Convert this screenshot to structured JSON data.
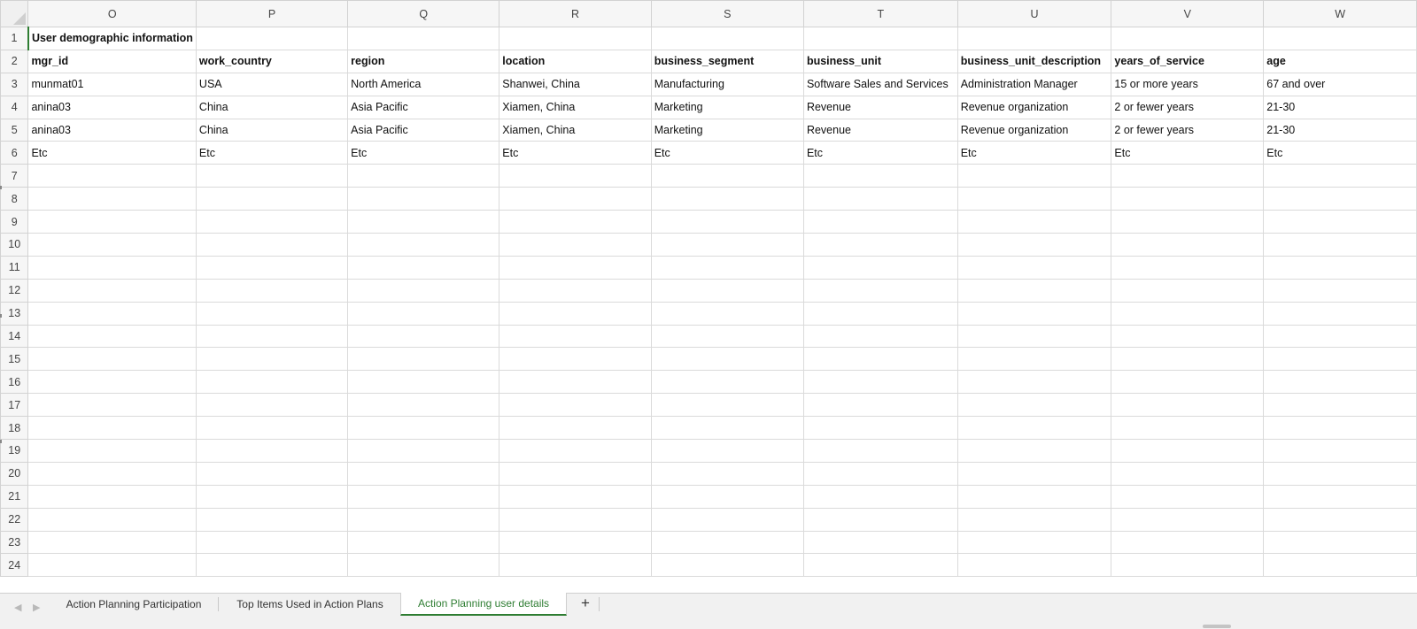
{
  "columns": [
    "O",
    "P",
    "Q",
    "R",
    "S",
    "T",
    "U",
    "V",
    "W"
  ],
  "rows": [
    {
      "num": "1",
      "cells": [
        "User demographic information",
        "",
        "",
        "",
        "",
        "",
        "",
        "",
        ""
      ]
    },
    {
      "num": "2",
      "cells": [
        "mgr_id",
        "work_country",
        "region",
        "location",
        "business_segment",
        "business_unit",
        "business_unit_description",
        "years_of_service",
        "age"
      ]
    },
    {
      "num": "3",
      "cells": [
        "munmat01",
        "USA",
        "North America",
        "Shanwei, China",
        "Manufacturing",
        "Software Sales and Services",
        "Administration Manager",
        "15 or more years",
        "67 and over"
      ]
    },
    {
      "num": "4",
      "cells": [
        "anina03",
        "China",
        "Asia Pacific",
        "Xiamen, China",
        "Marketing",
        "Revenue",
        "Revenue organization",
        "2 or fewer years",
        "21-30"
      ]
    },
    {
      "num": "5",
      "cells": [
        "anina03",
        "China",
        "Asia Pacific",
        "Xiamen, China",
        "Marketing",
        "Revenue",
        "Revenue organization",
        "2 or fewer years",
        "21-30"
      ]
    },
    {
      "num": "6",
      "cells": [
        "Etc",
        "Etc",
        "Etc",
        "Etc",
        "Etc",
        "Etc",
        "Etc",
        "Etc",
        "Etc"
      ]
    },
    {
      "num": "7",
      "cells": [
        "",
        "",
        "",
        "",
        "",
        "",
        "",
        "",
        ""
      ]
    },
    {
      "num": "8",
      "cells": [
        "",
        "",
        "",
        "",
        "",
        "",
        "",
        "",
        ""
      ]
    },
    {
      "num": "9",
      "cells": [
        "",
        "",
        "",
        "",
        "",
        "",
        "",
        "",
        ""
      ]
    },
    {
      "num": "10",
      "cells": [
        "",
        "",
        "",
        "",
        "",
        "",
        "",
        "",
        ""
      ]
    },
    {
      "num": "11",
      "cells": [
        "",
        "",
        "",
        "",
        "",
        "",
        "",
        "",
        ""
      ]
    },
    {
      "num": "12",
      "cells": [
        "",
        "",
        "",
        "",
        "",
        "",
        "",
        "",
        ""
      ]
    },
    {
      "num": "13",
      "cells": [
        "",
        "",
        "",
        "",
        "",
        "",
        "",
        "",
        ""
      ]
    },
    {
      "num": "14",
      "cells": [
        "",
        "",
        "",
        "",
        "",
        "",
        "",
        "",
        ""
      ]
    },
    {
      "num": "15",
      "cells": [
        "",
        "",
        "",
        "",
        "",
        "",
        "",
        "",
        ""
      ]
    },
    {
      "num": "16",
      "cells": [
        "",
        "",
        "",
        "",
        "",
        "",
        "",
        "",
        ""
      ]
    },
    {
      "num": "17",
      "cells": [
        "",
        "",
        "",
        "",
        "",
        "",
        "",
        "",
        ""
      ]
    },
    {
      "num": "18",
      "cells": [
        "",
        "",
        "",
        "",
        "",
        "",
        "",
        "",
        ""
      ]
    },
    {
      "num": "19",
      "cells": [
        "",
        "",
        "",
        "",
        "",
        "",
        "",
        "",
        ""
      ]
    },
    {
      "num": "20",
      "cells": [
        "",
        "",
        "",
        "",
        "",
        "",
        "",
        "",
        ""
      ]
    },
    {
      "num": "21",
      "cells": [
        "",
        "",
        "",
        "",
        "",
        "",
        "",
        "",
        ""
      ]
    },
    {
      "num": "22",
      "cells": [
        "",
        "",
        "",
        "",
        "",
        "",
        "",
        "",
        ""
      ]
    },
    {
      "num": "23",
      "cells": [
        "",
        "",
        "",
        "",
        "",
        "",
        "",
        "",
        ""
      ]
    },
    {
      "num": "24",
      "cells": [
        "",
        "",
        "",
        "",
        "",
        "",
        "",
        "",
        ""
      ]
    }
  ],
  "tabs": [
    {
      "label": "Action Planning Participation",
      "active": false
    },
    {
      "label": "Top Items Used in Action Plans",
      "active": false
    },
    {
      "label": "Action Planning user details",
      "active": true
    }
  ],
  "nav": {
    "prev_icon": "◀",
    "next_icon": "▶",
    "add_label": "+"
  },
  "colors": {
    "accent": "#2e7d32",
    "grid": "#dadada",
    "header_bg": "#f6f6f6"
  }
}
